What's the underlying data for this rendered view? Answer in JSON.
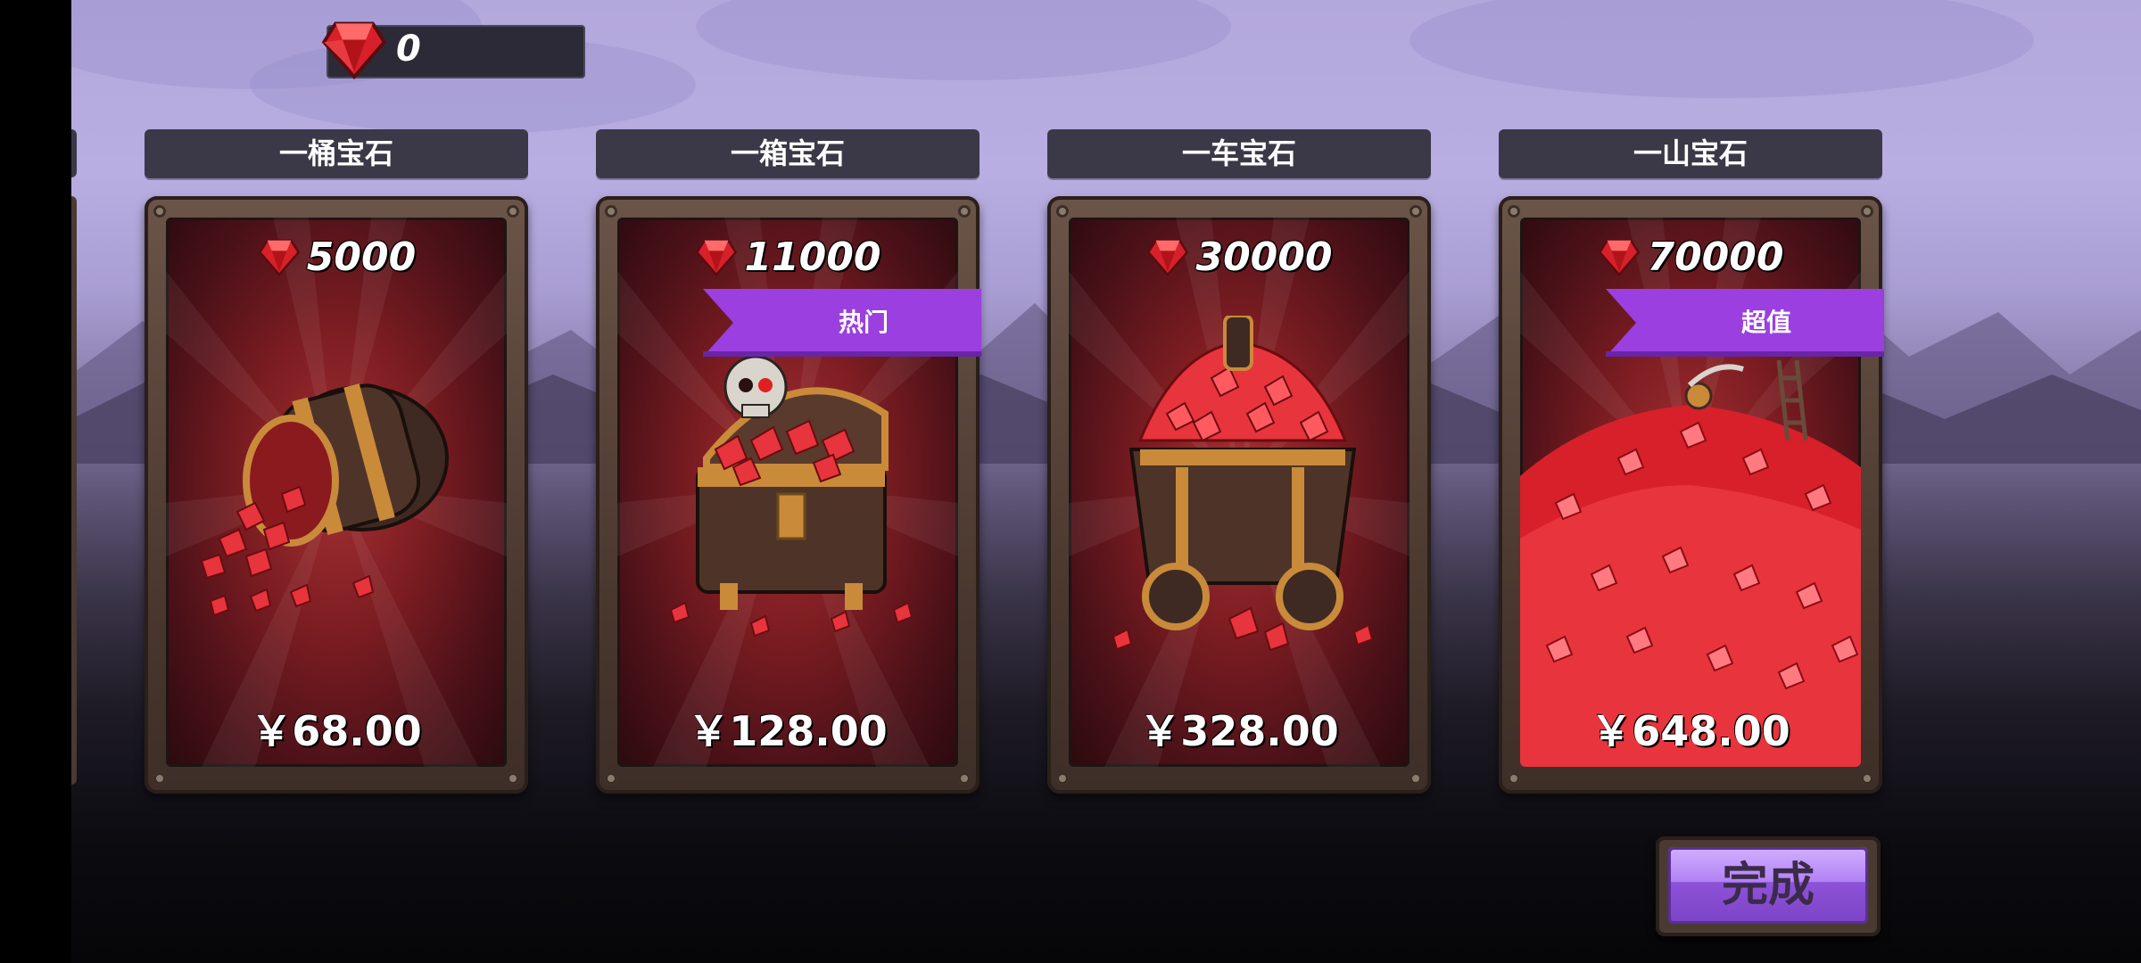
{
  "currency": {
    "icon": "ruby-gem-icon",
    "balance": "0"
  },
  "packs": [
    {
      "title": "一桶宝石",
      "amount": "5000",
      "price": "￥68.00",
      "badge": "",
      "art": "gem-barrel"
    },
    {
      "title": "一箱宝石",
      "amount": "11000",
      "price": "￥128.00",
      "badge": "热门",
      "art": "gem-treasure-chest"
    },
    {
      "title": "一车宝石",
      "amount": "30000",
      "price": "￥328.00",
      "badge": "",
      "art": "gem-cart"
    },
    {
      "title": "一山宝石",
      "amount": "70000",
      "price": "￥648.00",
      "badge": "超值",
      "art": "gem-mountain"
    }
  ],
  "done_button": {
    "label": "完成"
  },
  "colors": {
    "ribbon": "#9b3fe0",
    "card_inner": "#7c1d22",
    "button": "#b182f4"
  }
}
